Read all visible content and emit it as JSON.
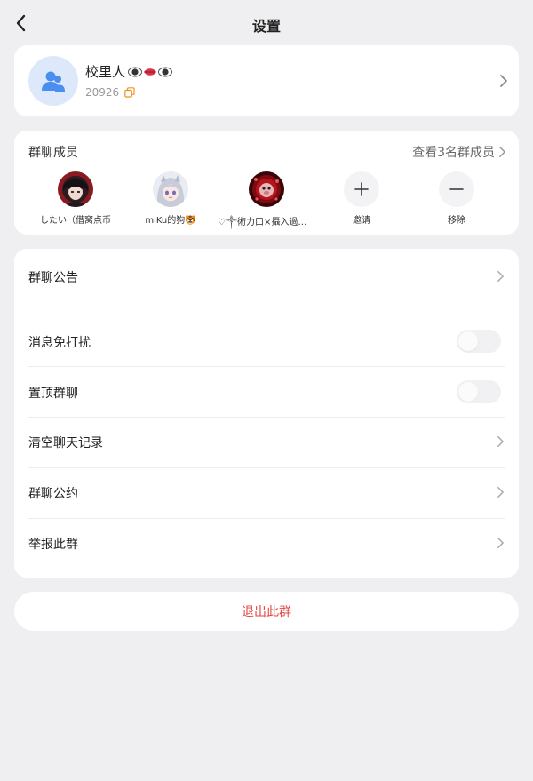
{
  "header": {
    "title": "设置"
  },
  "group": {
    "name": "校里人",
    "id": "20926"
  },
  "members": {
    "title": "群聊成员",
    "view_all": "查看3名群成员",
    "list": [
      {
        "name": "したい（借窝点币"
      },
      {
        "name": "miKu的狗🐯"
      },
      {
        "name": "♡༒術力口×攝入過量༒..."
      }
    ],
    "invite_label": "邀请",
    "remove_label": "移除"
  },
  "settings": {
    "announcement": "群聊公告",
    "do_not_disturb": "消息免打扰",
    "pin_chat": "置顶群聊",
    "clear_history": "清空聊天记录",
    "group_rules": "群聊公约",
    "report_group": "举报此群"
  },
  "toggles": {
    "do_not_disturb": false,
    "pin_chat": false
  },
  "exit_label": "退出此群",
  "colors": {
    "accent_blue": "#4a8ef0",
    "danger_red": "#e0473f",
    "background": "#efeff1"
  }
}
